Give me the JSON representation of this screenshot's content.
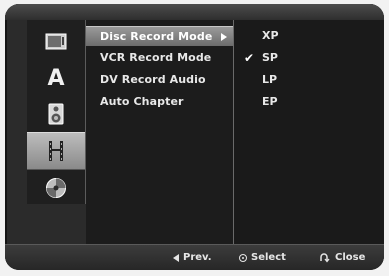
{
  "menu": {
    "items": [
      {
        "label": "Disc Record Mode"
      },
      {
        "label": "VCR Record Mode"
      },
      {
        "label": "DV Record Audio"
      },
      {
        "label": "Auto Chapter"
      }
    ],
    "selected_index": 0
  },
  "options": {
    "items": [
      {
        "label": "XP"
      },
      {
        "label": "SP",
        "checked": true
      },
      {
        "label": "LP"
      },
      {
        "label": "EP"
      }
    ]
  },
  "sidebar": {
    "icons": [
      {
        "name": "tv-screen-icon"
      },
      {
        "name": "language-a-icon",
        "glyph": "A"
      },
      {
        "name": "speaker-icon"
      },
      {
        "name": "film-icon",
        "active": true
      },
      {
        "name": "disc-icon"
      }
    ]
  },
  "footer": {
    "prev_label": "Prev.",
    "select_label": "Select",
    "close_label": "Close"
  },
  "colors": {
    "highlight": "#8a8a8a",
    "background": "#1c1c1c",
    "text": "#e8e8e8"
  }
}
